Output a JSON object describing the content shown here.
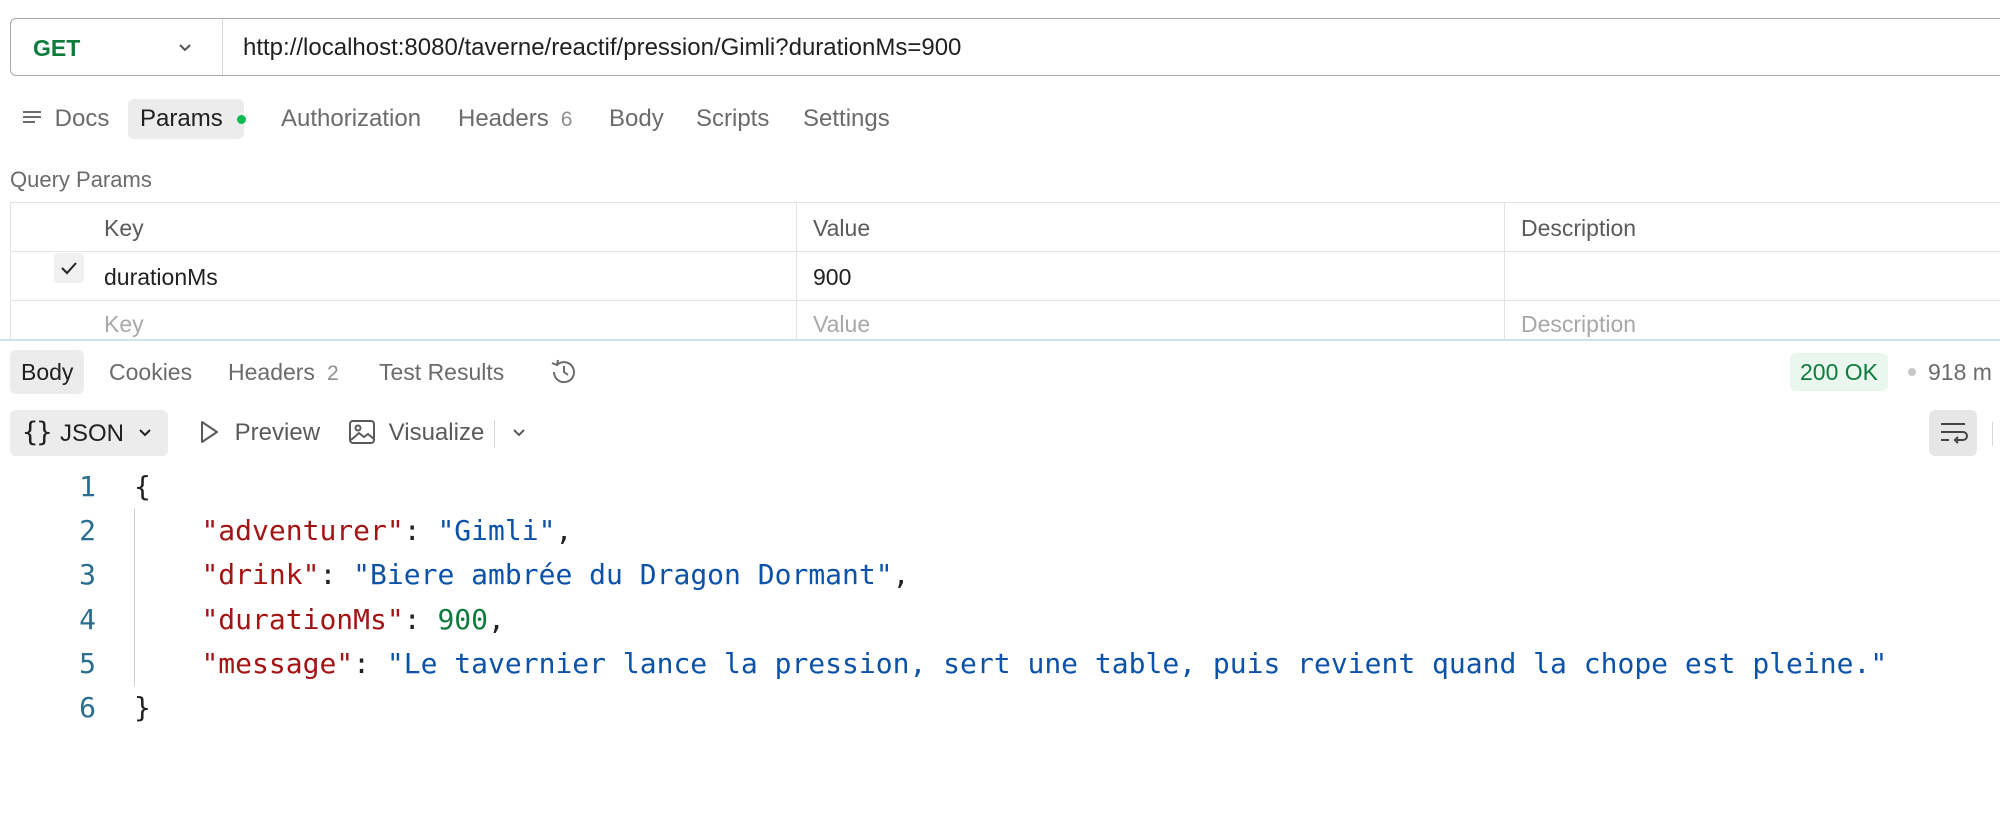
{
  "request": {
    "method": "GET",
    "url": "http://localhost:8080/taverne/reactif/pression/Gimli?durationMs=900"
  },
  "request_tabs": {
    "docs": "Docs",
    "params": "Params",
    "authorization": "Authorization",
    "headers": "Headers",
    "headers_count": "6",
    "body": "Body",
    "scripts": "Scripts",
    "settings": "Settings"
  },
  "query_params": {
    "title": "Query Params",
    "columns": {
      "key": "Key",
      "value": "Value",
      "description": "Description"
    },
    "rows": [
      {
        "checked": true,
        "key": "durationMs",
        "value": "900",
        "description": ""
      }
    ],
    "placeholders": {
      "key": "Key",
      "value": "Value",
      "description": "Description"
    }
  },
  "response_tabs": {
    "body": "Body",
    "cookies": "Cookies",
    "headers": "Headers",
    "headers_count": "2",
    "test_results": "Test Results"
  },
  "response_meta": {
    "status": "200 OK",
    "time": "918 m"
  },
  "body_toolbar": {
    "format_brace": "{}",
    "format": "JSON",
    "preview": "Preview",
    "visualize": "Visualize"
  },
  "response_body": {
    "line_numbers": [
      "1",
      "2",
      "3",
      "4",
      "5",
      "6"
    ],
    "open_brace": "{",
    "close_brace": "}",
    "fields": [
      {
        "key": "\"adventurer\"",
        "value": "\"Gimli\"",
        "type": "string"
      },
      {
        "key": "\"drink\"",
        "value": "\"Biere ambrée du Dragon Dormant\"",
        "type": "string"
      },
      {
        "key": "\"durationMs\"",
        "value": "900",
        "type": "number"
      },
      {
        "key": "\"message\"",
        "value": "\"Le tavernier lance la pression, sert une table, puis revient quand la chope est pleine.\"",
        "type": "string"
      }
    ]
  },
  "colors": {
    "method": "#0f7b3d",
    "status_ok": "#0f7b3d",
    "json_key": "#a31515",
    "json_string": "#0b52a8",
    "json_number": "#0f7b3d",
    "params_dot": "#0cbb52"
  }
}
